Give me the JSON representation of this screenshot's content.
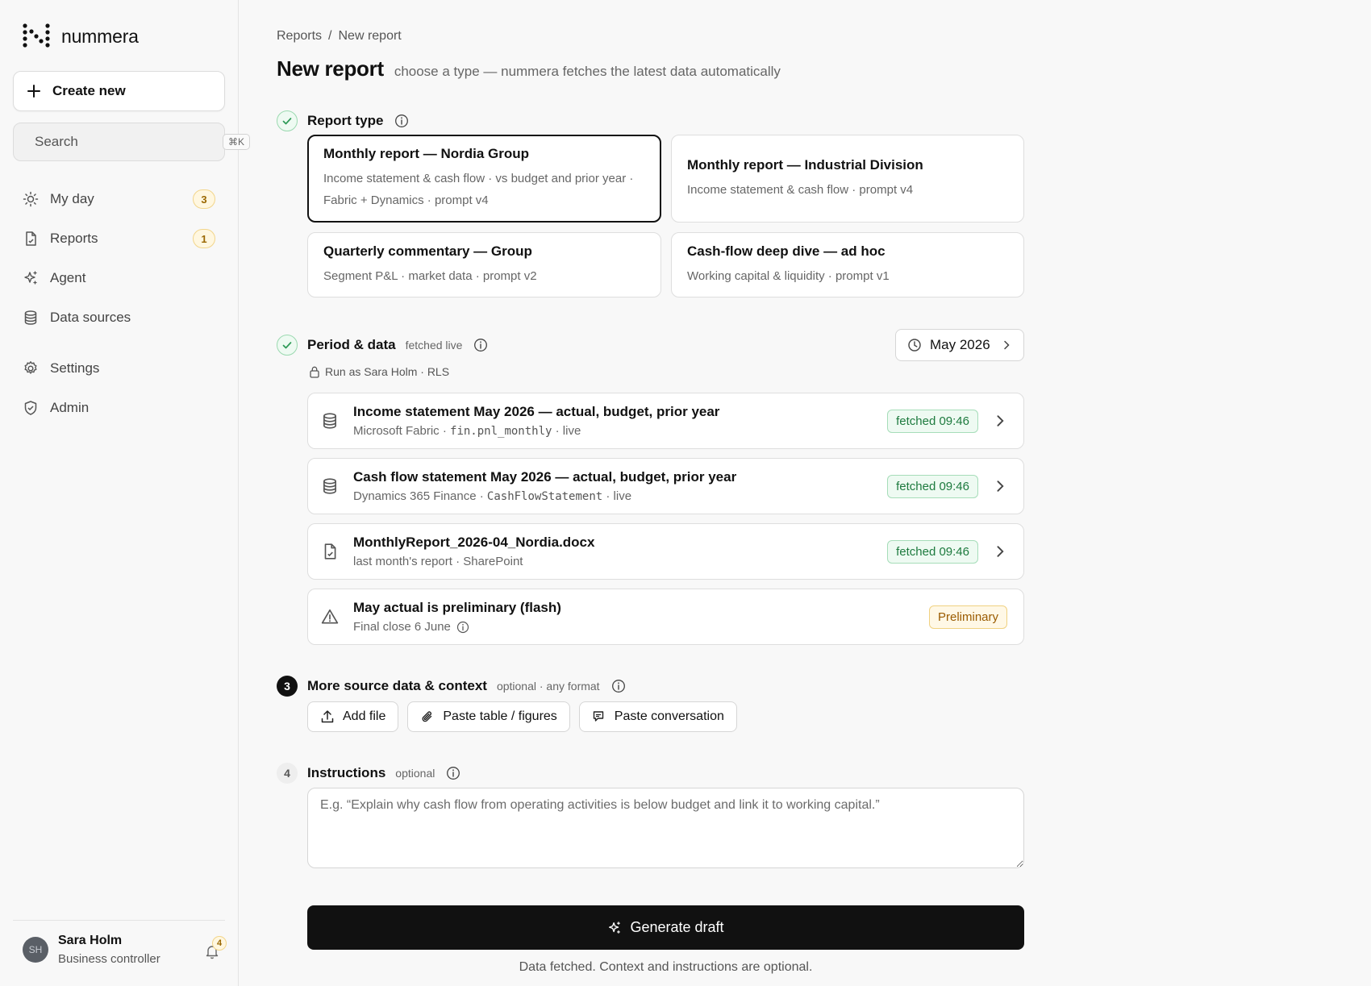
{
  "app": {
    "name": "nummera"
  },
  "sidebar": {
    "create_label": "Create new",
    "search_placeholder": "Search",
    "search_shortcut": "⌘K",
    "items": [
      {
        "label": "My day",
        "icon": "sun-icon",
        "badge": "3"
      },
      {
        "label": "Reports",
        "icon": "file-icon",
        "badge": "1"
      },
      {
        "label": "Agent",
        "icon": "sparkles-icon",
        "badge": ""
      },
      {
        "label": "Data sources",
        "icon": "database-icon",
        "badge": ""
      },
      {
        "label": "Settings",
        "icon": "gear-icon",
        "badge": ""
      },
      {
        "label": "Admin",
        "icon": "shield-icon",
        "badge": ""
      }
    ]
  },
  "user": {
    "initials": "SH",
    "name": "Sara Holm",
    "role": "Business controller",
    "notifications": "4"
  },
  "breadcrumb": {
    "parent": "Reports",
    "separator": "/",
    "current": "New report"
  },
  "header": {
    "title": "New report",
    "subtitle": "choose a type — nummera fetches the latest data automatically"
  },
  "report_type": {
    "title": "Report type",
    "cards": [
      {
        "title": "Monthly report — Nordia Group",
        "desc": "Income statement & cash flow · vs budget and prior year · Fabric + Dynamics · prompt v4",
        "selected": true
      },
      {
        "title": "Monthly report — Industrial Division",
        "desc": "Income statement & cash flow · prompt v4",
        "selected": false
      },
      {
        "title": "Quarterly commentary — Group",
        "desc": "Segment P&L · market data · prompt v2",
        "selected": false
      },
      {
        "title": "Cash-flow deep dive — ad hoc",
        "desc": "Working capital & liquidity · prompt v1",
        "selected": false
      }
    ]
  },
  "period": {
    "title": "Period & data",
    "note": "fetched live",
    "period_label": "May 2026",
    "run_as": "Run as Sara Holm · RLS",
    "sources": [
      {
        "title": "Income statement May 2026 — actual, budget, prior year",
        "meta_pre": "Microsoft Fabric · ",
        "meta_code": "fin.pnl_monthly",
        "meta_post": " · live",
        "badge": "fetched 09:46"
      },
      {
        "title": "Cash flow statement May 2026 — actual, budget, prior year",
        "meta_pre": "Dynamics 365 Finance · ",
        "meta_code": "CashFlowStatement",
        "meta_post": " · live",
        "badge": "fetched 09:46"
      },
      {
        "title": "MonthlyReport_2026-04_Nordia.docx",
        "meta": "last month's report · SharePoint",
        "badge": "fetched 09:46"
      }
    ],
    "warning": {
      "title": "May actual is preliminary (flash)",
      "meta": "Final close 6 June",
      "badge": "Preliminary"
    }
  },
  "context": {
    "step": "3",
    "title": "More source data & context",
    "note": "optional · any format",
    "buttons": [
      "Add file",
      "Paste table / figures",
      "Paste conversation"
    ]
  },
  "instructions": {
    "step": "4",
    "title": "Instructions",
    "note": "optional",
    "placeholder": "E.g. “Explain why cash flow from operating activities is below budget and link it to working capital.”"
  },
  "generate": {
    "label": "Generate draft",
    "footnote": "Data fetched. Context and instructions are optional."
  }
}
